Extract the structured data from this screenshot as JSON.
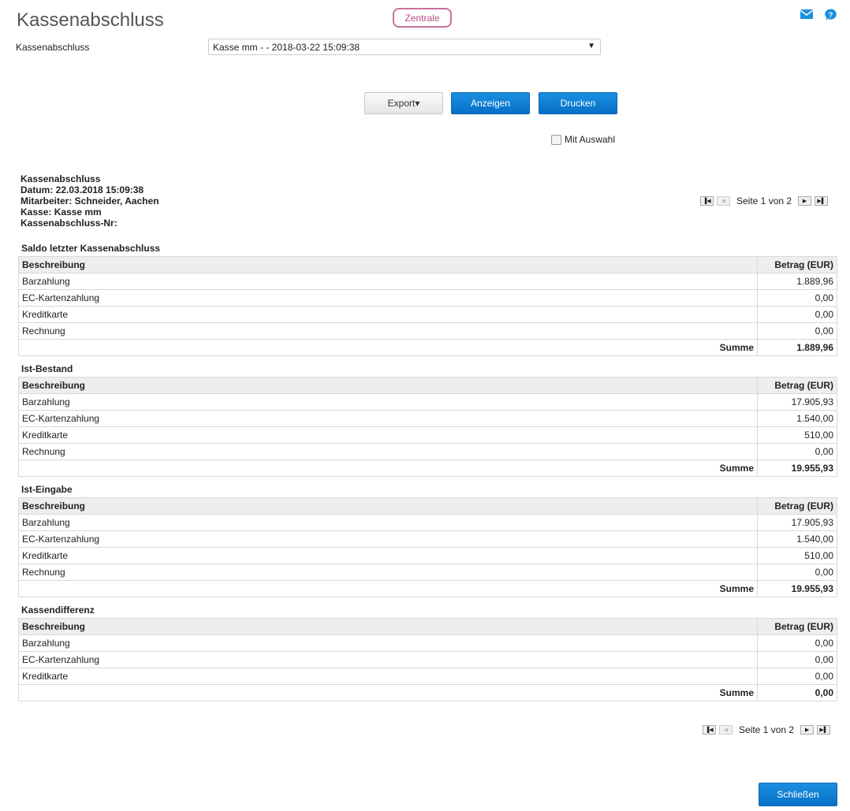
{
  "header": {
    "title": "Kassenabschluss",
    "badge": "Zentrale",
    "icons": [
      "mail-icon",
      "help-icon"
    ]
  },
  "selector": {
    "label": "Kassenabschluss",
    "value": "Kasse mm - - 2018-03-22 15:09:38"
  },
  "buttons": {
    "export": "Export▾",
    "anzeigen": "Anzeigen",
    "drucken": "Drucken",
    "close": "Schließen"
  },
  "checkbox": {
    "label": "Mit Auswahl"
  },
  "info": {
    "title": "Kassenabschluss",
    "datum": "Datum: 22.03.2018 15:09:38",
    "mitarbeiter": "Mitarbeiter: Schneider, Aachen",
    "kasse": "Kasse: Kasse mm",
    "nr": "Kassenabschluss-Nr:"
  },
  "pager": {
    "text": "Seite 1 von 2"
  },
  "columns": {
    "desc": "Beschreibung",
    "amount": "Betrag (EUR)",
    "sum": "Summe"
  },
  "sections": [
    {
      "title": "Saldo letzter Kassenabschluss",
      "rows": [
        {
          "desc": "Barzahlung",
          "amount": "1.889,96"
        },
        {
          "desc": "EC-Kartenzahlung",
          "amount": "0,00"
        },
        {
          "desc": "Kreditkarte",
          "amount": "0,00"
        },
        {
          "desc": "Rechnung",
          "amount": "0,00"
        }
      ],
      "sum": "1.889,96"
    },
    {
      "title": "Ist-Bestand",
      "rows": [
        {
          "desc": "Barzahlung",
          "amount": "17.905,93"
        },
        {
          "desc": "EC-Kartenzahlung",
          "amount": "1.540,00"
        },
        {
          "desc": "Kreditkarte",
          "amount": "510,00"
        },
        {
          "desc": "Rechnung",
          "amount": "0,00"
        }
      ],
      "sum": "19.955,93"
    },
    {
      "title": "Ist-Eingabe",
      "rows": [
        {
          "desc": "Barzahlung",
          "amount": "17.905,93"
        },
        {
          "desc": "EC-Kartenzahlung",
          "amount": "1.540,00"
        },
        {
          "desc": "Kreditkarte",
          "amount": "510,00"
        },
        {
          "desc": "Rechnung",
          "amount": "0,00"
        }
      ],
      "sum": "19.955,93"
    },
    {
      "title": "Kassendifferenz",
      "rows": [
        {
          "desc": "Barzahlung",
          "amount": "0,00"
        },
        {
          "desc": "EC-Kartenzahlung",
          "amount": "0,00"
        },
        {
          "desc": "Kreditkarte",
          "amount": "0,00"
        }
      ],
      "sum": "0,00"
    }
  ]
}
